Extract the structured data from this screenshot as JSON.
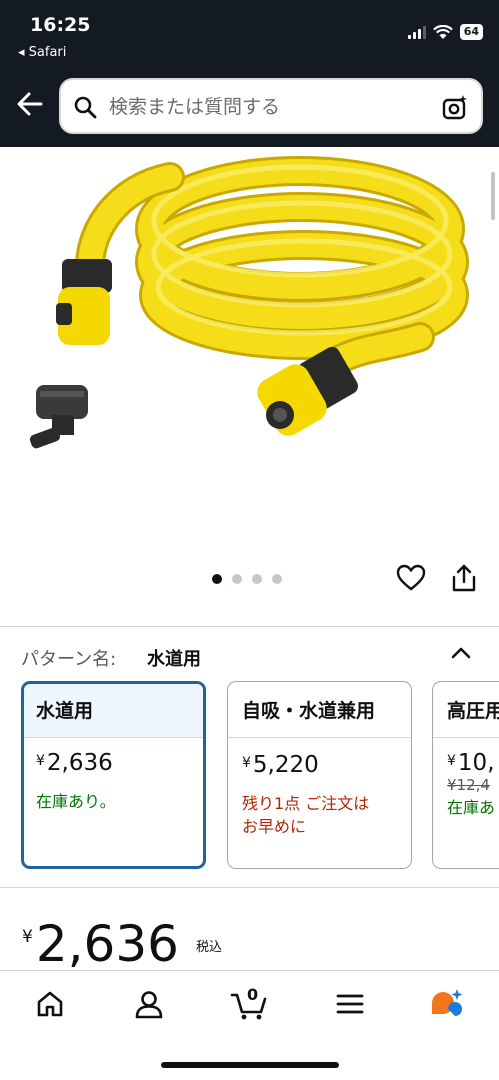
{
  "status_bar": {
    "time": "16:25",
    "back_app": "◂ Safari",
    "battery": "64"
  },
  "search": {
    "placeholder": "検索または質問する"
  },
  "gallery": {
    "page_count": 4,
    "active_page": 1
  },
  "pattern": {
    "label": "パターン名:",
    "value": "水道用"
  },
  "options": [
    {
      "name": "水道用",
      "yen": "¥",
      "price": "2,636",
      "old_price": "",
      "stock": "在庫あり。",
      "stock_color": "#007600",
      "selected": true
    },
    {
      "name": "自吸・水道兼用",
      "yen": "¥",
      "price": "5,220",
      "old_price": "",
      "stock": "残り1点 ご注文はお早めに",
      "stock_color": "#b12704",
      "selected": false
    },
    {
      "name": "高圧用",
      "yen": "¥",
      "price": "10,",
      "old_price": "¥12,4",
      "stock": "在庫あ",
      "stock_color": "#007600",
      "selected": false
    }
  ],
  "price": {
    "yen": "¥",
    "amount": "2,636",
    "tax_label": "税込"
  },
  "nav": {
    "cart_count": "0",
    "items": [
      "home-icon",
      "account-icon",
      "cart-icon",
      "menu-icon",
      "rufus-icon"
    ]
  },
  "colors": {
    "header_bg": "#131a22",
    "selected_border": "#2162a1",
    "in_stock": "#007600",
    "low_stock": "#b12704",
    "hose_yellow": "#f5dd1a"
  }
}
